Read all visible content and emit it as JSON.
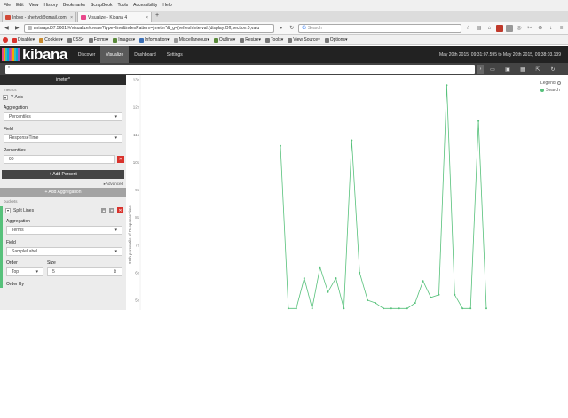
{
  "firefox": {
    "menu": [
      "File",
      "Edit",
      "View",
      "History",
      "Bookmarks",
      "ScrapBook",
      "Tools",
      "Accessibility",
      "Help"
    ],
    "tabs": [
      {
        "title": "Inbox - shettyd@gmail.com",
        "close": "×",
        "active": false,
        "favicon_color": "#d14836"
      },
      {
        "title": "Visualize - Kibana 4",
        "close": "×",
        "active": true,
        "favicon_color": "#e8478b"
      }
    ],
    "newtab": "+",
    "url": "unisrapd07:5601/#/visualize/create?type=line&indexPattern=jmeter*&_g=(refreshInterval:(display:Off,section:0,valu",
    "search_placeholder": "Search",
    "bookmarks": [
      {
        "label": "Disable▾",
        "color": "#d9322c"
      },
      {
        "label": "Cookies▾",
        "color": "#c98b2e"
      },
      {
        "label": "CSS▾",
        "color": "#777777"
      },
      {
        "label": "Forms▾",
        "color": "#777777"
      },
      {
        "label": "Images▾",
        "color": "#5a8a3a"
      },
      {
        "label": "Information▾",
        "color": "#3b6fb6"
      },
      {
        "label": "Miscellaneous▾",
        "color": "#999999"
      },
      {
        "label": "Outline▾",
        "color": "#5a8a3a"
      },
      {
        "label": "Resize▾",
        "color": "#777777"
      },
      {
        "label": "Tools▾",
        "color": "#777777"
      },
      {
        "label": "View Source▾",
        "color": "#777777"
      },
      {
        "label": "Options▾",
        "color": "#777777"
      }
    ]
  },
  "kibana": {
    "logo": "kibana",
    "logo_stripes": [
      "#e8478b",
      "#f5a700",
      "#3ebeb0",
      "#00a9e0",
      "#9b59b6",
      "#e8478b",
      "#f5a700",
      "#3ebeb0",
      "#00a9e0",
      "#9b59b6"
    ],
    "nav": [
      {
        "label": "Discover",
        "active": false
      },
      {
        "label": "Visualize",
        "active": true
      },
      {
        "label": "Dashboard",
        "active": false
      },
      {
        "label": "Settings",
        "active": false
      }
    ],
    "timerange": "May 20th 2015, 09:31:07.595 to May 20th 2015, 09:38:03.139",
    "query": "*",
    "query_button": "›"
  },
  "sidebar": {
    "title": "jmeter*",
    "metrics_label": "metrics",
    "y_axis": "Y-Axis",
    "aggregation_label": "Aggregation",
    "aggregation_value": "Percentiles",
    "field_label": "Field",
    "field_value": "ResponseTime",
    "percentiles_label": "Percentiles",
    "percentile_value": "90",
    "add_percent": "+ Add Percent",
    "advanced": "▸Advanced",
    "add_aggregation": "+ Add Aggregation",
    "buckets_label": "buckets",
    "split_lines": "Split Lines",
    "bucket_aggregation_label": "Aggregation",
    "bucket_aggregation_value": "Terms",
    "bucket_field_label": "Field",
    "bucket_field_value": "SampleLabel",
    "order_label": "Order",
    "order_value": "Top",
    "size_label": "Size",
    "size_value": "5",
    "order_by_label": "Order By"
  },
  "legend": {
    "title": "Legend",
    "series": "Search"
  },
  "colors": {
    "line": "#57c17b",
    "accent_green": "#57c17b",
    "delete_red": "#d9322c"
  },
  "chart_data": {
    "type": "line",
    "ylabel": "90th percentile of ResponseTime",
    "ytick_labels": [
      "13k",
      "12k",
      "11k",
      "10k",
      "9k",
      "8k",
      "7k",
      "6k",
      "5k"
    ],
    "y_visible_range": [
      4700,
      13000
    ],
    "series": [
      {
        "name": "Search",
        "values": [
          10600,
          4700,
          4700,
          5800,
          4700,
          6200,
          5300,
          5800,
          4700,
          10800,
          6000,
          5000,
          4900,
          4700,
          4700,
          4700,
          4700,
          4900,
          5700,
          5100,
          5200,
          12800,
          5200,
          4700,
          4700,
          11500,
          4700
        ]
      }
    ]
  }
}
